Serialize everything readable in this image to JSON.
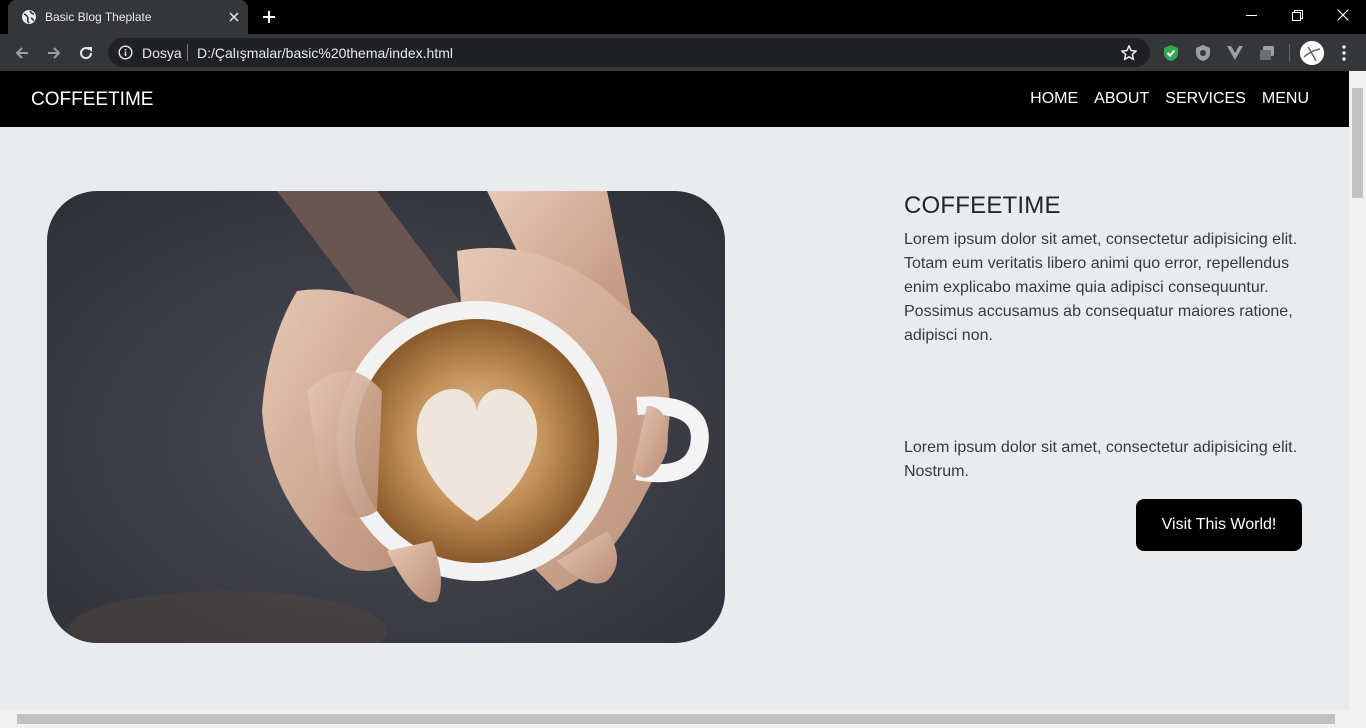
{
  "browser": {
    "tab_title": "Basic Blog Theplate",
    "scheme_label": "Dosya",
    "url": "D:/Çalışmalar/basic%20thema/index.html"
  },
  "site": {
    "brand": "COFFEETIME",
    "nav": [
      "HOME",
      "ABOUT",
      "SERVICES",
      "MENU"
    ]
  },
  "hero": {
    "heading": "COFFEETIME",
    "paragraph1": "Lorem ipsum dolor sit amet, consectetur adipisicing elit. Totam eum veritatis libero animi quo error, repellendus enim explicabo maxime quia adipisci consequuntur. Possimus accusamus ab consequatur maiores ratione, adipisci non.",
    "paragraph2": "Lorem ipsum dolor sit amet, consectetur adipisicing elit. Nostrum.",
    "button_label": "Visit This World!",
    "image_subject": "hands holding latte cup with heart art"
  },
  "colors": {
    "nav_bg": "#000000",
    "page_bg": "#e9ecef",
    "button_bg": "#000000"
  }
}
